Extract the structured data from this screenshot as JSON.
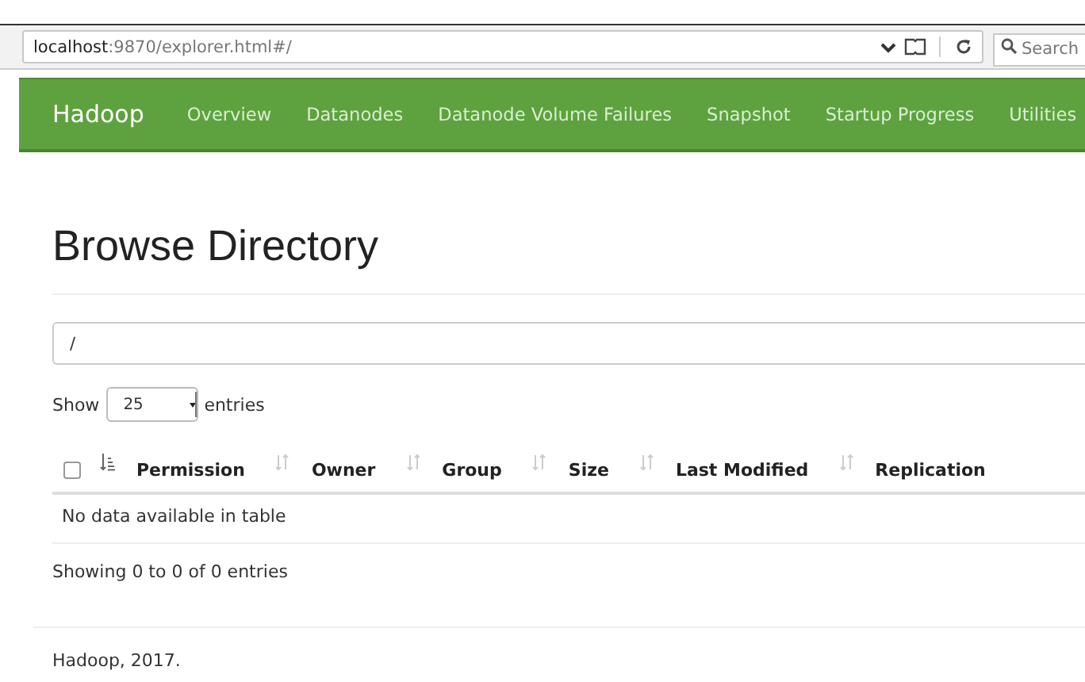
{
  "browser": {
    "url_host": "localhost",
    "url_path": ":9870/explorer.html#/",
    "search_placeholder": "Search"
  },
  "navbar": {
    "brand": "Hadoop",
    "items": [
      {
        "label": "Overview",
        "selected": false
      },
      {
        "label": "Datanodes",
        "selected": false
      },
      {
        "label": "Datanode Volume Failures",
        "selected": false
      },
      {
        "label": "Snapshot",
        "selected": false
      },
      {
        "label": "Startup Progress",
        "selected": false
      },
      {
        "label": "Utilities",
        "selected": false
      }
    ]
  },
  "heading": "Browse Directory",
  "path_field": {
    "value": "/"
  },
  "length_control": {
    "before": "Show",
    "value": "25",
    "after": "entries"
  },
  "table": {
    "select_all_checked": false,
    "columns": [
      {
        "label": "Permission",
        "sorted": true
      },
      {
        "label": "Owner",
        "sorted": false
      },
      {
        "label": "Group",
        "sorted": false
      },
      {
        "label": "Size",
        "sorted": false
      },
      {
        "label": "Last Modified",
        "sorted": false
      },
      {
        "label": "Replication",
        "sorted": false
      }
    ],
    "empty_message": "No data available in table"
  },
  "info": "Showing 0 to 0 of 0 entries",
  "footer": "Hadoop, 2017."
}
